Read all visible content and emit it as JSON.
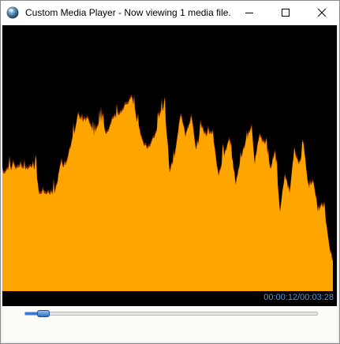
{
  "window": {
    "title": "Custom Media Player - Now viewing 1 media file."
  },
  "icons": {
    "app": "media-player-globe-icon",
    "minimize": "minimize-icon",
    "maximize": "maximize-icon",
    "close": "close-icon"
  },
  "player": {
    "time_readout": "00:00:12/00:03:28",
    "progress": 0.06
  },
  "colors": {
    "waveform_fill": "#ffa500",
    "waveform_edge": "#8b2a00",
    "video_background": "#000000",
    "time_text": "#5b9bd5",
    "seek_accent": "#3c7bd0"
  }
}
